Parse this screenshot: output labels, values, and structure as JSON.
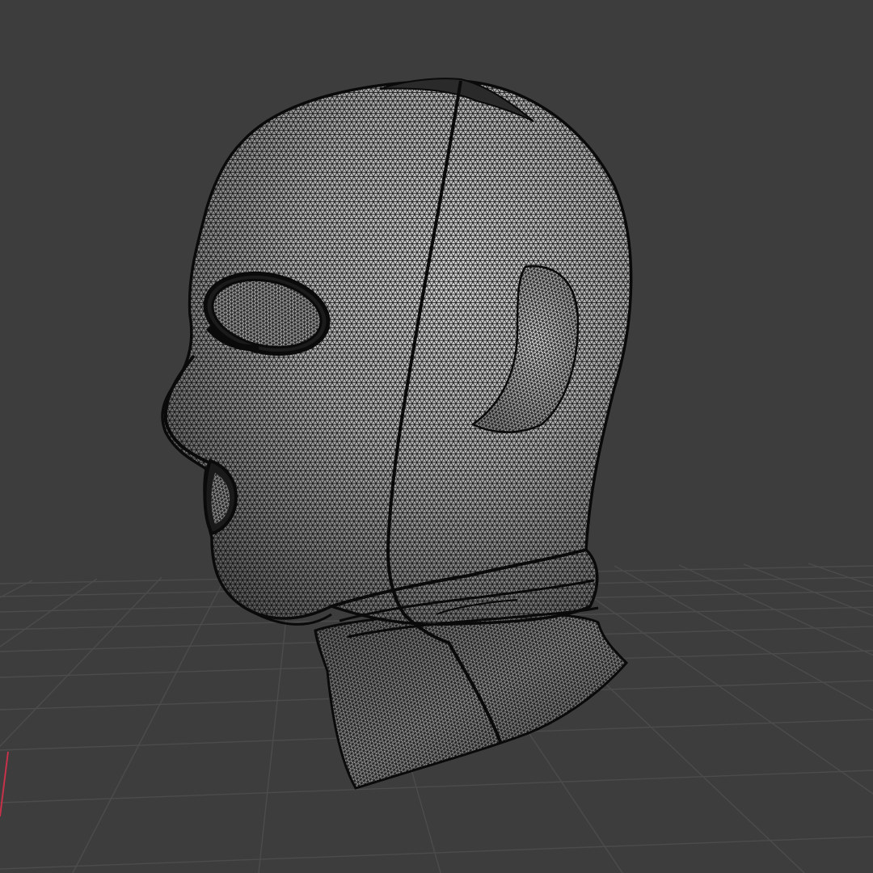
{
  "viewport": {
    "background_color": "#3d3d3d",
    "grid_color": "#4a4a4a",
    "x_axis_color": "#c7324a"
  },
  "model": {
    "object": "balaclava-mask",
    "display_mode": "wireframe-over-solid",
    "surface_color": "#c8c8c8",
    "wire_color": "#0a0a0a"
  }
}
